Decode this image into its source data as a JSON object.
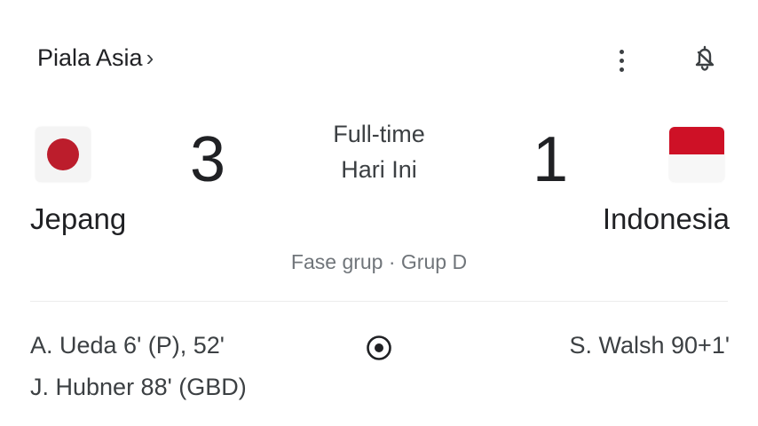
{
  "competition": {
    "label": "Piala Asia",
    "chevron": "›"
  },
  "match": {
    "status": "Full-time",
    "date": "Hari Ini",
    "stage": "Fase grup · Grup D",
    "home": {
      "name": "Jepang",
      "score": "3",
      "flag_icon": "japan-flag-icon",
      "flag_colors": [
        "#ffffff",
        "#bc1d2c"
      ]
    },
    "away": {
      "name": "Indonesia",
      "score": "1",
      "flag_icon": "indonesia-flag-icon",
      "flag_colors": [
        "#ce1126",
        "#ffffff"
      ]
    }
  },
  "goals": {
    "home": [
      "A. Ueda 6' (P), 52'",
      "J. Hubner 88' (GBD)"
    ],
    "away": [
      "S. Walsh 90+1'"
    ],
    "icon": "soccer-ball-icon"
  },
  "icons": {
    "more": "more-vert-icon",
    "notify": "notification-bell-icon"
  }
}
